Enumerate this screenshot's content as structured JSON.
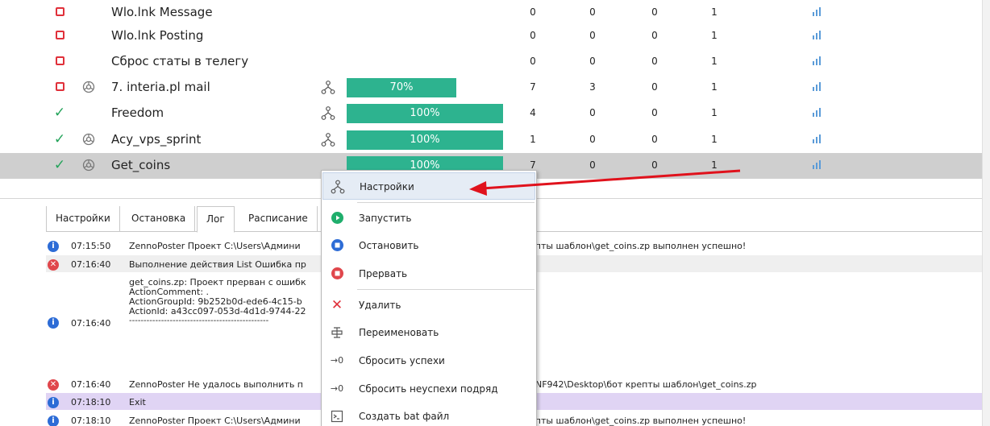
{
  "projects": [
    {
      "status": "stopped",
      "browser": false,
      "name": "Wlo.lnk Message",
      "tree": false,
      "progress_pct": null,
      "progress_label": "",
      "n1": "0",
      "n2": "0",
      "n3": "0",
      "n4": "1"
    },
    {
      "status": "stopped",
      "browser": false,
      "name": "Wlo.lnk Posting",
      "tree": false,
      "progress_pct": null,
      "progress_label": "",
      "n1": "0",
      "n2": "0",
      "n3": "0",
      "n4": "1"
    },
    {
      "status": "stopped",
      "browser": false,
      "name": "Сброс статы в телегу",
      "tree": false,
      "progress_pct": null,
      "progress_label": "",
      "n1": "0",
      "n2": "0",
      "n3": "0",
      "n4": "1"
    },
    {
      "status": "stopped",
      "browser": true,
      "name": "7. interia.pl mail",
      "tree": true,
      "progress_pct": 70,
      "progress_label": "70%",
      "n1": "7",
      "n2": "3",
      "n3": "0",
      "n4": "1"
    },
    {
      "status": "done",
      "browser": false,
      "name": "Freedom",
      "tree": true,
      "progress_pct": 100,
      "progress_label": "100%",
      "n1": "4",
      "n2": "0",
      "n3": "0",
      "n4": "1"
    },
    {
      "status": "done",
      "browser": true,
      "name": "Acy_vps_sprint",
      "tree": true,
      "progress_pct": 100,
      "progress_label": "100%",
      "n1": "1",
      "n2": "0",
      "n3": "0",
      "n4": "1"
    },
    {
      "status": "done",
      "browser": true,
      "name": "Get_coins",
      "tree": false,
      "progress_pct": 100,
      "progress_label": "100%",
      "n1": "7",
      "n2": "0",
      "n3": "0",
      "n4": "1",
      "selected": true
    }
  ],
  "tabs": [
    "Настройки",
    "Остановка",
    "Лог",
    "Расписание"
  ],
  "active_tab": "Лог",
  "log": [
    {
      "type": "info",
      "time": "07:15:50",
      "text_left": "ZennoPoster Проект C:\\Users\\Админи",
      "text_right": "репты шаблон\\get_coins.zp выполнен успешно!"
    },
    {
      "type": "err",
      "time": "07:16:40",
      "text_left": "Выполнение действия List Ошибка пр",
      "text_right": ""
    },
    {
      "type": "info",
      "time": "07:16:40",
      "lines": [
        "get_coins.zp: Проект прерван с ошибк",
        "ActionComment: .",
        "ActionGroupId: 9b252b0d-ede6-4c15-b",
        "ActionId: a43cc097-053d-4d1d-9744-22",
        "------------------------------------------------"
      ]
    },
    {
      "type": "err",
      "time": "07:16:40",
      "text_left": "ZennoPoster Не удалось выполнить п",
      "text_right": "99NF942\\Desktop\\бот крепты шаблон\\get_coins.zp"
    },
    {
      "type": "info",
      "time": "07:18:10",
      "text_left": "Exit",
      "text_right": ""
    },
    {
      "type": "info",
      "time": "07:18:10",
      "text_left": "ZennoPoster Проект C:\\Users\\Админи",
      "text_right": "репты шаблон\\get_coins.zp выполнен успешно!"
    }
  ],
  "context_menu": {
    "items": [
      {
        "icon": "tree-icon",
        "label": "Настройки",
        "highlighted": true
      },
      {
        "icon": "play-icon",
        "label": "Запустить"
      },
      {
        "icon": "stop-icon",
        "label": "Остановить"
      },
      {
        "icon": "abort-icon",
        "label": "Прервать"
      },
      {
        "icon": "delete-icon",
        "label": "Удалить"
      },
      {
        "icon": "rename-icon",
        "label": "Переименовать"
      },
      {
        "icon": "reset-icon",
        "label": "Сбросить успехи"
      },
      {
        "icon": "reset-icon",
        "label": "Сбросить неуспехи подряд"
      },
      {
        "icon": "bat-file-icon",
        "label": "Создать bat файл"
      }
    ]
  },
  "colors": {
    "progress": "#2db38f",
    "selected_row": "#cfcfcf",
    "stopped_status": "#e0303a",
    "done_status": "#23a35a",
    "annotation_arrow": "#e0121c",
    "log_highlight": "#e0d4f4"
  }
}
